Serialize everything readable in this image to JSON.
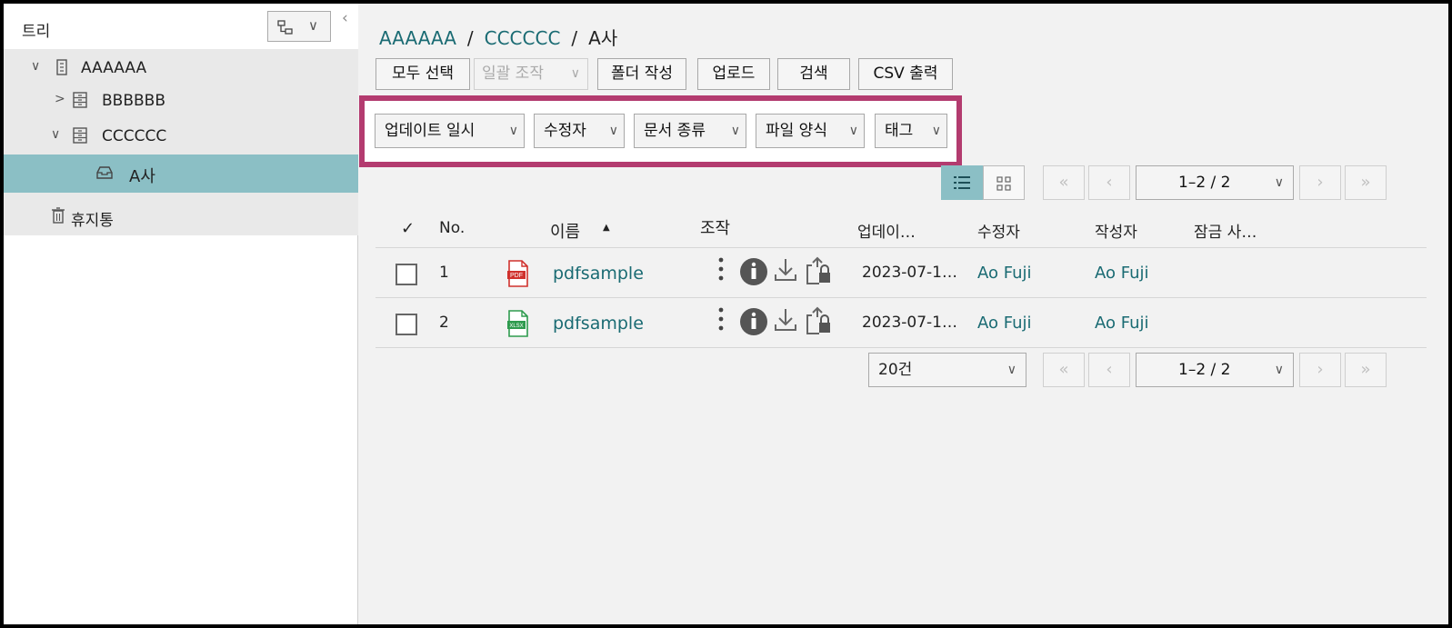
{
  "tree": {
    "title": "트리",
    "nodes": [
      {
        "label": "AAAAAA",
        "toggle": "∨"
      },
      {
        "label": "BBBBBB",
        "toggle": ">"
      },
      {
        "label": "CCCCCC",
        "toggle": "∨"
      },
      {
        "label": "A사"
      },
      {
        "label": "휴지통"
      }
    ]
  },
  "breadcrumb": {
    "items": [
      "AAAAAA",
      "CCCCCC"
    ],
    "current": "A사",
    "separator": "/"
  },
  "toolbar": {
    "select_all": "모두 선택",
    "bulk_ops": "일괄 조작",
    "create_folder": "폴더 작성",
    "upload": "업로드",
    "search": "검색",
    "csv_export": "CSV 출력"
  },
  "filters": [
    "업데이트 일시",
    "수정자",
    "문서 종류",
    "파일 양식",
    "태그"
  ],
  "pager": {
    "range": "1–2 / 2",
    "per_page": "20건"
  },
  "table": {
    "headers": {
      "check": "✓",
      "no": "No.",
      "name": "이름",
      "sort_indicator": "▲",
      "ops": "조작",
      "updated": "업데이…",
      "modifier": "수정자",
      "creator": "작성자",
      "lock": "잠금 사…"
    },
    "rows": [
      {
        "no": "1",
        "name": "pdfsample",
        "type": "PDF",
        "updated": "2023-07-1…",
        "modifier": "Ao Fuji",
        "creator": "Ao Fuji"
      },
      {
        "no": "2",
        "name": "pdfsample",
        "type": "XLSX",
        "updated": "2023-07-1…",
        "modifier": "Ao Fuji",
        "creator": "Ao Fuji"
      }
    ]
  },
  "colors": {
    "accent": "#1a6b73",
    "selected": "#8bbfc5",
    "highlight_border": "#b33b6f",
    "pdf": "#d0312d",
    "xlsx": "#2e9b4e"
  }
}
